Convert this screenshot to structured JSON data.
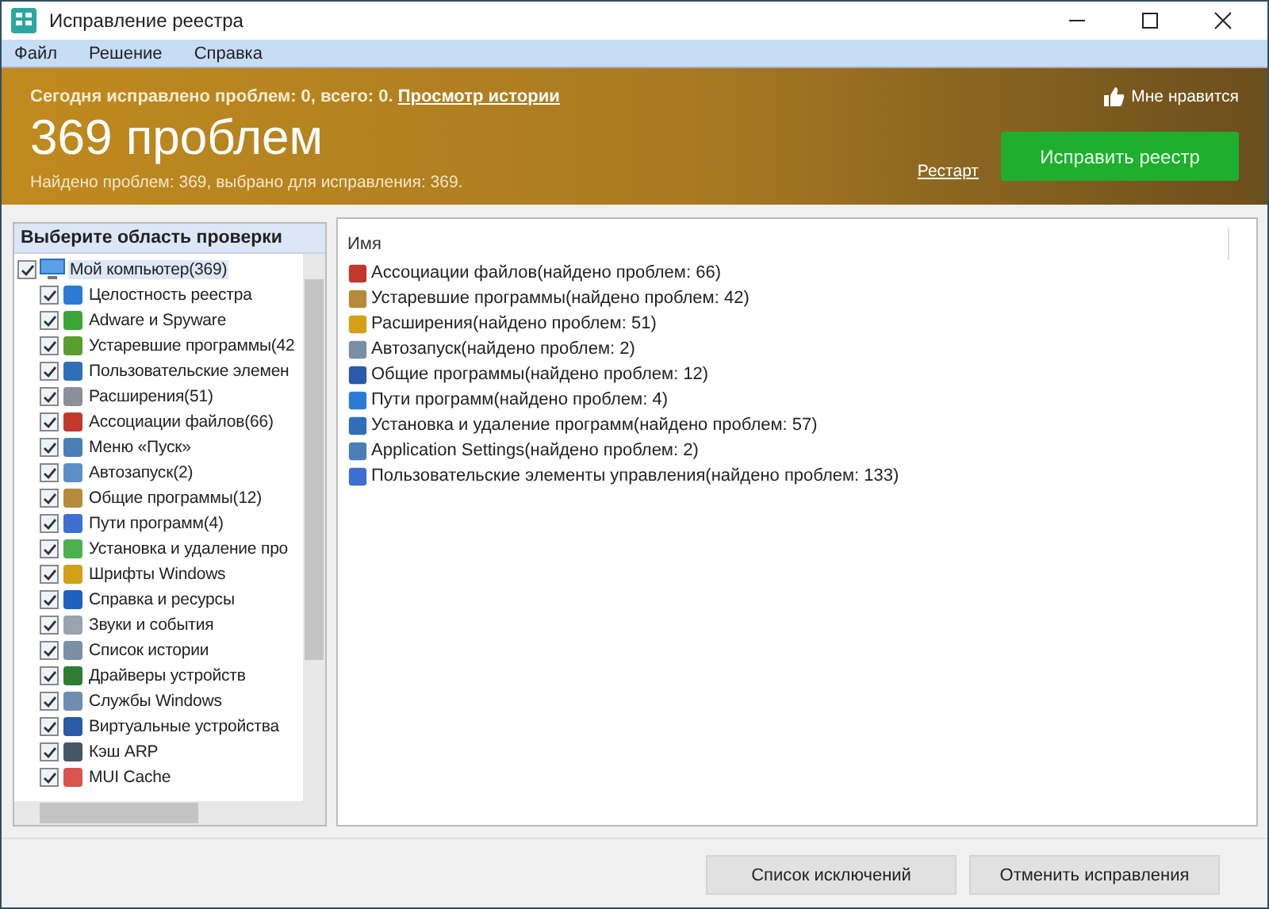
{
  "window": {
    "title": "Исправление реестра"
  },
  "menu": [
    "Файл",
    "Решение",
    "Справка"
  ],
  "banner": {
    "today": "Сегодня исправлено проблем: 0, всего: 0.",
    "history_link": "Просмотр истории",
    "like": "Мне нравится",
    "headline": "369 проблем",
    "summary": "Найдено проблем: 369, выбрано для исправления: 369.",
    "restart_link": "Рестарт",
    "fix_button": "Исправить реестр"
  },
  "scan_area": {
    "title": "Выберите область проверки",
    "tree": [
      {
        "label": "Мой компьютер(369)",
        "checked": true,
        "selected": true,
        "children": [
          {
            "label": "Целостность реестра",
            "checked": true,
            "selected": false
          },
          {
            "label": "Adware и Spyware",
            "checked": true,
            "selected": false
          },
          {
            "label": "Устаревшие программы(42",
            "checked": true,
            "selected": false
          },
          {
            "label": "Пользовательские элемен",
            "checked": true,
            "selected": false
          },
          {
            "label": "Расширения(51)",
            "checked": true,
            "selected": false
          },
          {
            "label": "Ассоциации файлов(66)",
            "checked": true,
            "selected": false
          },
          {
            "label": "Меню «Пуск»",
            "checked": true,
            "selected": false
          },
          {
            "label": "Автозапуск(2)",
            "checked": true,
            "selected": false
          },
          {
            "label": "Общие программы(12)",
            "checked": true,
            "selected": false
          },
          {
            "label": "Пути программ(4)",
            "checked": true,
            "selected": false
          },
          {
            "label": "Установка и удаление про",
            "checked": true,
            "selected": false
          },
          {
            "label": "Шрифты Windows",
            "checked": true,
            "selected": false
          },
          {
            "label": "Справка и ресурсы",
            "checked": true,
            "selected": false
          },
          {
            "label": "Звуки и события",
            "checked": true,
            "selected": false
          },
          {
            "label": "Список истории",
            "checked": true,
            "selected": false
          },
          {
            "label": "Драйверы устройств",
            "checked": true,
            "selected": false
          },
          {
            "label": "Службы Windows",
            "checked": true,
            "selected": false
          },
          {
            "label": "Виртуальные устройства",
            "checked": true,
            "selected": false
          },
          {
            "label": "Кэш ARP",
            "checked": true,
            "selected": false
          },
          {
            "label": "MUI Cache",
            "checked": true,
            "selected": false
          }
        ]
      }
    ]
  },
  "results": {
    "column": "Имя",
    "rows": [
      "Ассоциации файлов(найдено проблем: 66)",
      "Устаревшие программы(найдено проблем: 42)",
      "Расширения(найдено проблем: 51)",
      "Автозапуск(найдено проблем: 2)",
      "Общие программы(найдено проблем: 12)",
      "Пути программ(найдено проблем: 4)",
      "Установка и удаление программ(найдено проблем: 57)",
      "Application Settings(найдено проблем: 2)",
      "Пользовательские элементы управления(найдено проблем: 133)"
    ]
  },
  "buttons": [
    "Список исключений",
    "Отменить исправления"
  ]
}
